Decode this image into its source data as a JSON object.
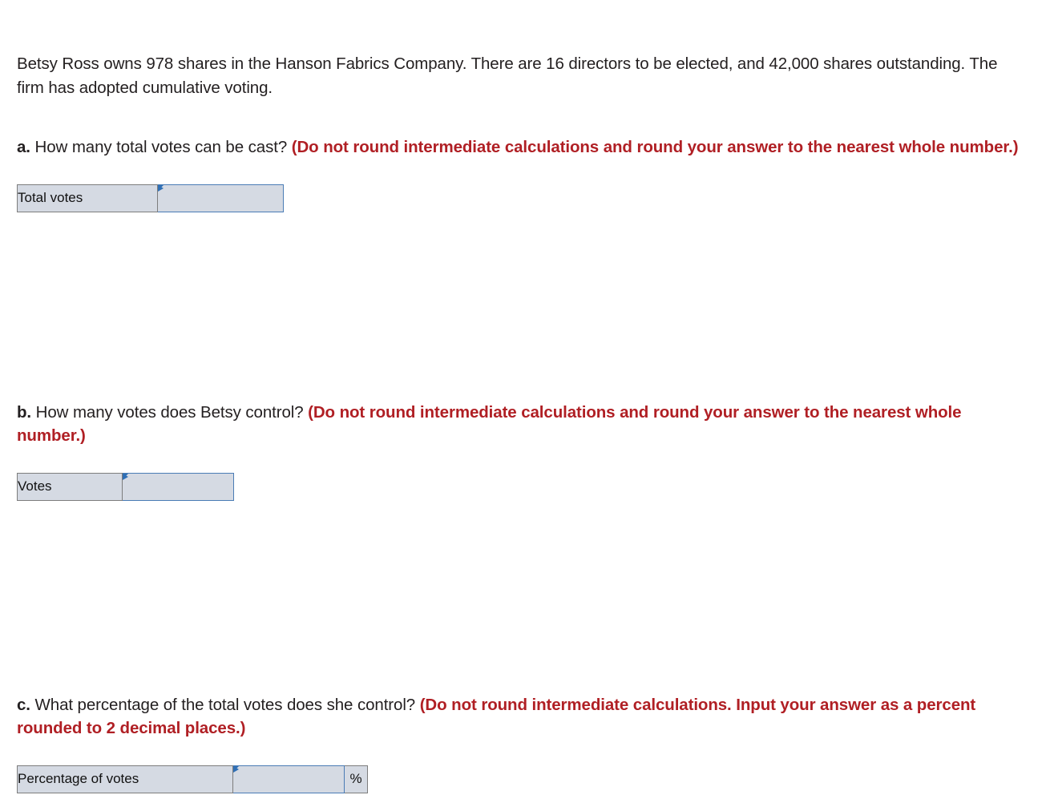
{
  "problem": {
    "stem": "Betsy Ross owns 978 shares in the Hanson Fabrics Company. There are 16 directors to be elected, and 42,000 shares outstanding. The firm has adopted cumulative voting."
  },
  "questions": [
    {
      "letter": "a.",
      "prompt": "How many total votes can be cast?",
      "instruction": "(Do not round intermediate calculations and round your answer to the nearest whole number.)",
      "answer_label": "Total votes",
      "answer_value": "",
      "answer_placeholder": "",
      "suffix": ""
    },
    {
      "letter": "b.",
      "prompt": "How many votes does Betsy control?",
      "instruction": "(Do not round intermediate calculations and round your answer to the nearest whole number.)",
      "answer_label": "Votes",
      "answer_value": "",
      "answer_placeholder": "",
      "suffix": ""
    },
    {
      "letter": "c.",
      "prompt": "What percentage of the total votes does she control?",
      "instruction": "(Do not round intermediate calculations. Input your answer as a percent rounded to 2 decimal places.)",
      "answer_label": "Percentage of votes",
      "answer_value": "",
      "answer_placeholder": "",
      "suffix": "%"
    }
  ],
  "colors": {
    "instruction_red": "#b01f24",
    "field_fill": "#d5dae3",
    "field_border_blue": "#4a7cb5",
    "label_border_gray": "#7d7d7d",
    "flag_blue": "#2f6fb5",
    "body_text": "#231f20"
  }
}
